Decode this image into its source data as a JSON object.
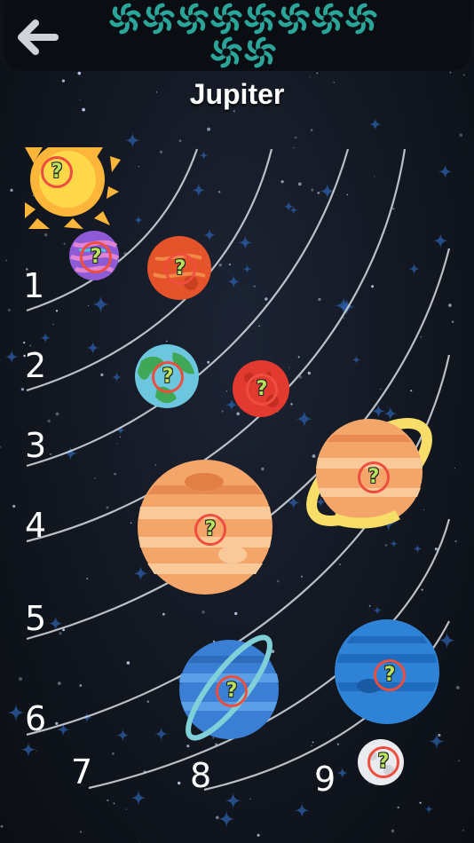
{
  "header": {
    "title": "Jupiter",
    "back_icon": "back-arrow-icon",
    "progress_icon": "spiral-galaxy-icon",
    "progress_count": 10
  },
  "orbit_numbers": [
    "1",
    "2",
    "3",
    "4",
    "5",
    "6",
    "7",
    "8",
    "9"
  ],
  "quiz_marker": "?",
  "colors": {
    "background": "#151b26",
    "orbit_line": "#d9dde3",
    "marker_ring": "#ef4e3f",
    "marker_text": "#b9e35c",
    "galaxy_icon": "#2aa59a"
  }
}
